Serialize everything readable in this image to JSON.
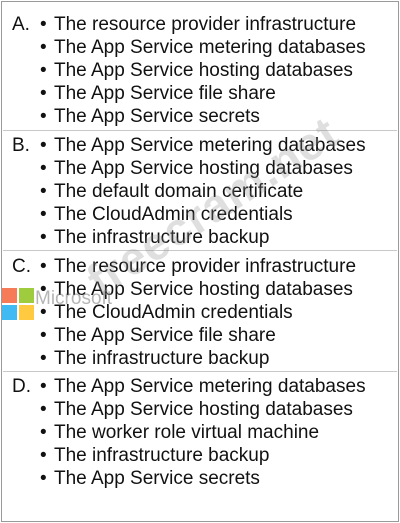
{
  "options": [
    {
      "letter": "A.",
      "items": [
        "The resource provider infrastructure",
        "The App Service metering databases",
        "The App Service hosting databases",
        "The App Service file share",
        "The App Service secrets"
      ]
    },
    {
      "letter": "B.",
      "items": [
        "The App Service metering databases",
        "The App Service hosting databases",
        "The default domain certificate",
        "The CloudAdmin credentials",
        "The infrastructure backup"
      ]
    },
    {
      "letter": "C.",
      "items": [
        "The resource provider infrastructure",
        "The App Service hosting databases",
        "The CloudAdmin credentials",
        "The App Service file share",
        "The infrastructure backup"
      ]
    },
    {
      "letter": "D.",
      "items": [
        "The App Service metering databases",
        "The App Service hosting databases",
        "The worker role virtual machine",
        "The infrastructure backup",
        "The App Service secrets"
      ]
    }
  ],
  "bullet": "•",
  "watermark": {
    "text": "freecram.net",
    "logo_word": "Microsoft",
    "logo_colors": [
      "#f25022",
      "#7fba00",
      "#00a4ef",
      "#ffb900"
    ]
  }
}
